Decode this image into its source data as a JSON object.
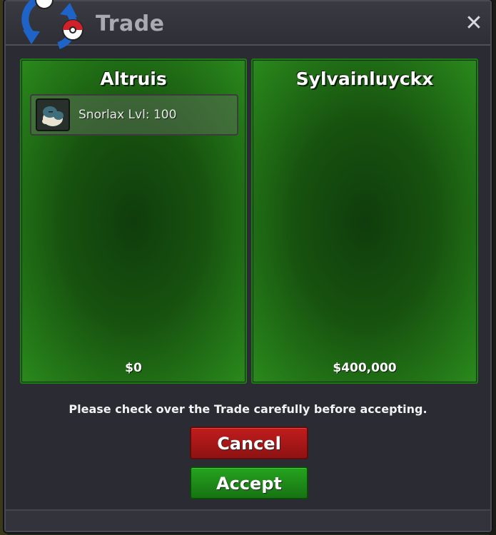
{
  "window": {
    "title": "Trade",
    "close_label": "✕"
  },
  "left_panel": {
    "player_name": "Altruis",
    "money": "$0",
    "items": [
      {
        "label": "Snorlax  Lvl: 100",
        "icon": "snorlax-icon"
      }
    ]
  },
  "right_panel": {
    "player_name": "Sylvainluyckx",
    "money": "$400,000",
    "items": []
  },
  "notice": "Please check over the Trade carefully before accepting.",
  "buttons": {
    "cancel_label": "Cancel",
    "accept_label": "Accept"
  },
  "colors": {
    "panel_green": "#1f7a16",
    "cancel_red": "#c01d1d",
    "accept_green": "#25a31e",
    "window_bg": "#2a2b33"
  }
}
